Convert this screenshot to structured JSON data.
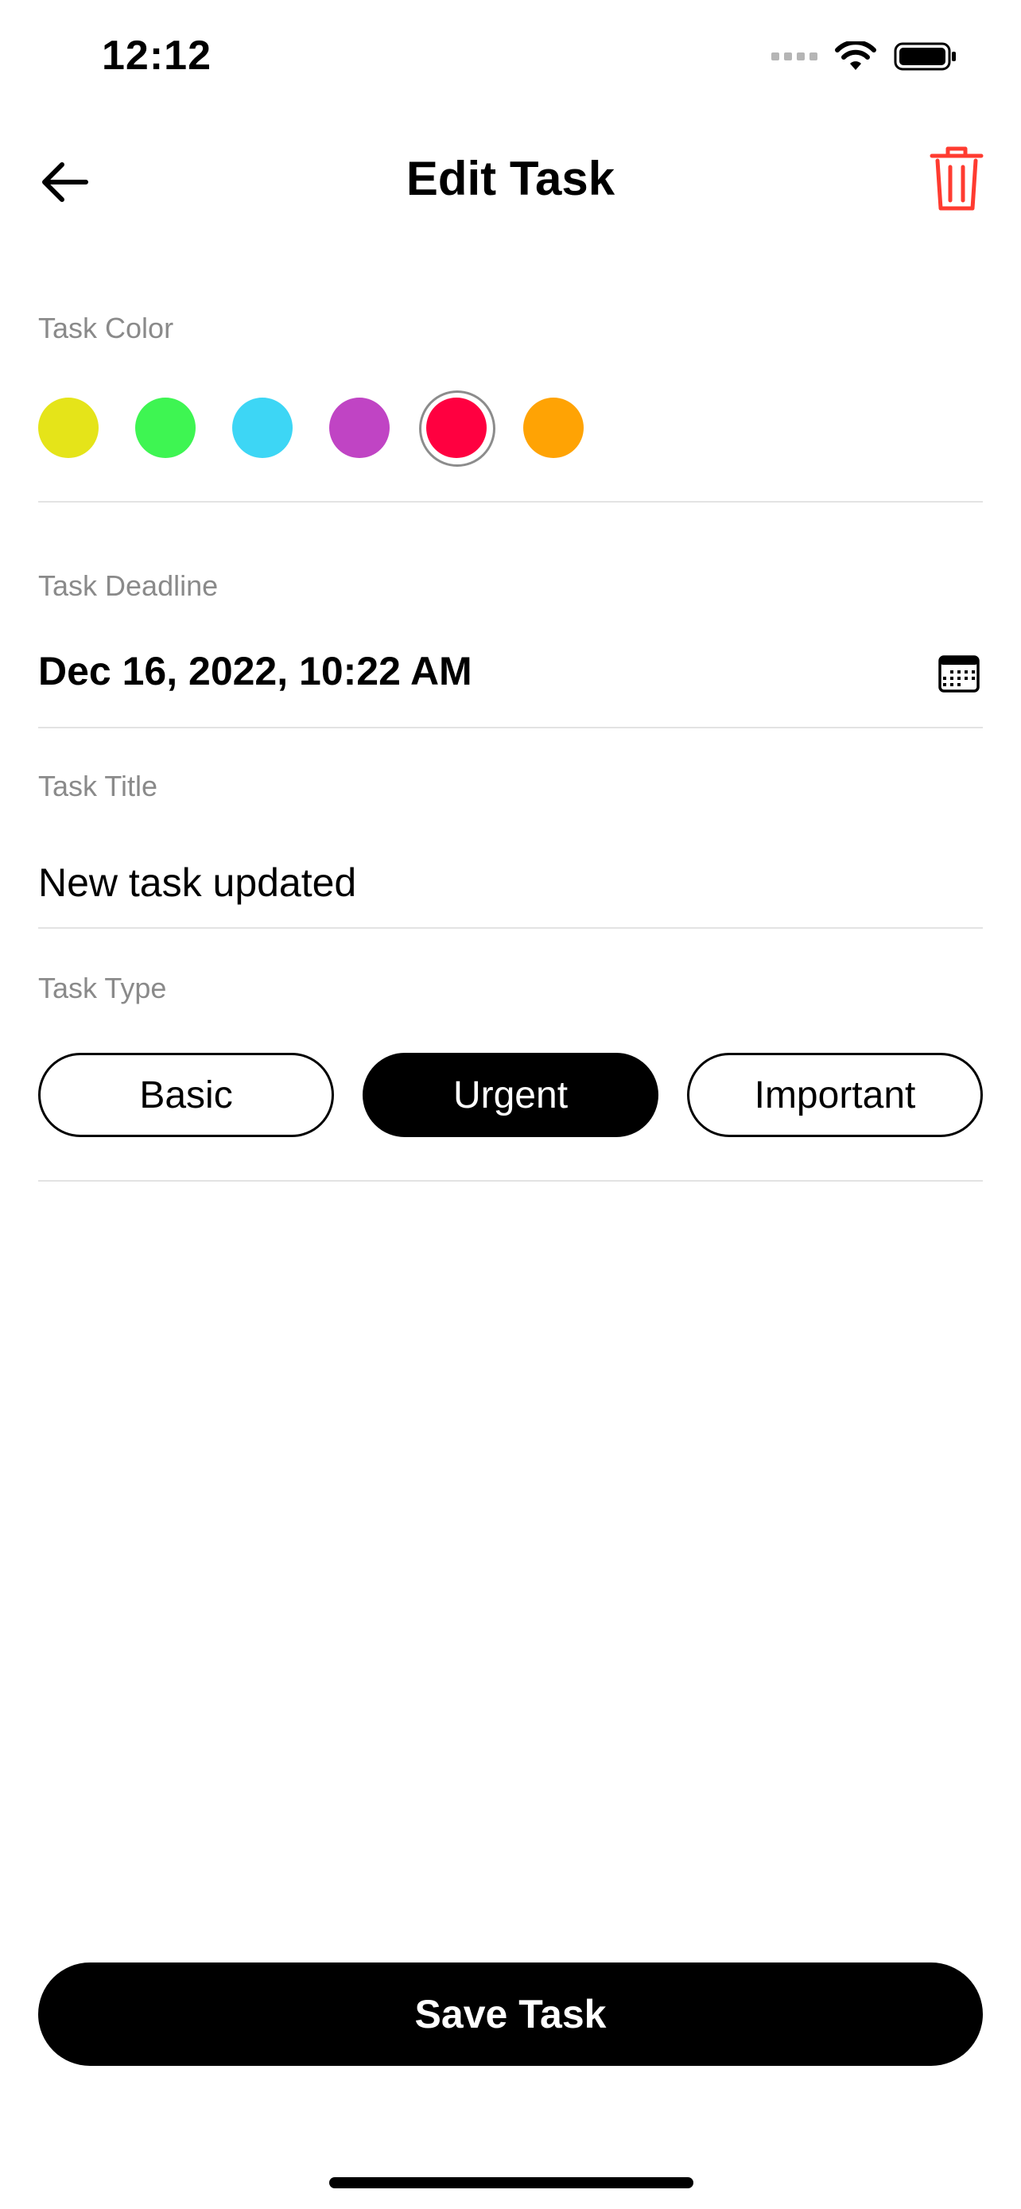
{
  "status_bar": {
    "time": "12:12",
    "icons": [
      "cellular-signal-icon",
      "wifi-icon",
      "battery-icon"
    ]
  },
  "nav": {
    "title": "Edit Task",
    "back_icon": "arrow-left-icon",
    "delete_icon": "trash-icon",
    "delete_color": "#ff3b30"
  },
  "task_color": {
    "label": "Task Color",
    "swatches": [
      {
        "name": "yellow",
        "color": "#e5e419"
      },
      {
        "name": "green",
        "color": "#3ef552"
      },
      {
        "name": "cyan",
        "color": "#3dd6f5"
      },
      {
        "name": "purple",
        "color": "#c044c4"
      },
      {
        "name": "red",
        "color": "#ff0040",
        "selected": true
      },
      {
        "name": "orange",
        "color": "#ffa304"
      }
    ]
  },
  "deadline": {
    "label": "Task Deadline",
    "value": "Dec 16, 2022, 10:22 AM",
    "icon": "calendar-icon"
  },
  "title_field": {
    "label": "Task Title",
    "value": "New task updated"
  },
  "task_type": {
    "label": "Task Type",
    "options": [
      {
        "label": "Basic",
        "selected": false
      },
      {
        "label": "Urgent",
        "selected": true
      },
      {
        "label": "Important",
        "selected": false
      }
    ]
  },
  "save_button": {
    "label": "Save Task"
  }
}
